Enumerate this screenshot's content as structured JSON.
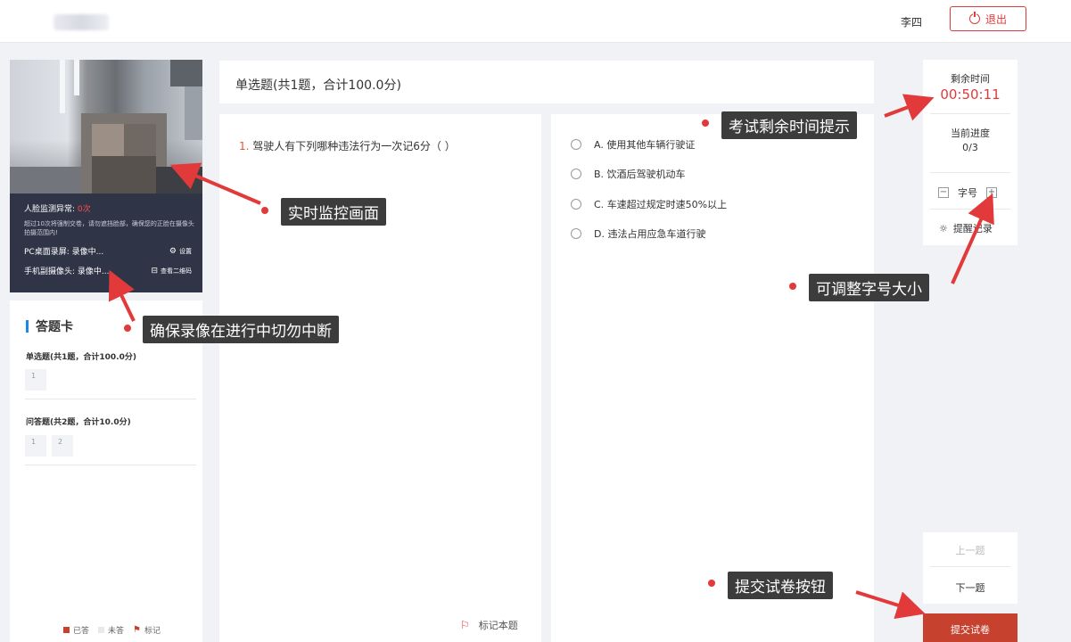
{
  "topbar": {
    "username": "李四",
    "logout_label": "退出"
  },
  "monitor": {
    "face_status_label": "人脸监测异常:",
    "face_status_count": "0次",
    "warning": "超过10次将强制交卷，请勿遮挡脸部，确保您的正脸在摄像头拍摄范围内!",
    "pc_record_label": "PC桌面录屏: 录像中...",
    "settings_label": "设置",
    "mobile_record_label": "手机副摄像头: 录像中...",
    "qr_label": "查看二维码"
  },
  "answer_card": {
    "title": "答题卡",
    "sections": [
      {
        "label": "单选题(共1题，合计100.0分)",
        "items": [
          "1"
        ]
      },
      {
        "label": "问答题(共2题，合计10.0分)",
        "items": [
          "1",
          "2"
        ]
      }
    ],
    "legend": {
      "answered": "已答",
      "unanswered": "未答",
      "marked": "标记"
    },
    "colors": {
      "answered": "#c7412f",
      "unanswered": "#e8e9ee",
      "marked": "#c7412f"
    }
  },
  "exam": {
    "section_header": "单选题(共1题，合计100.0分)",
    "question_number": "1.",
    "question_text": "驾驶人有下列哪种违法行为一次记6分（  ）",
    "mark_label": "标记本题",
    "options": [
      {
        "letter": "A.",
        "text": "使用其他车辆行驶证"
      },
      {
        "letter": "B.",
        "text": "饮酒后驾驶机动车"
      },
      {
        "letter": "C.",
        "text": "车速超过规定时速50%以上"
      },
      {
        "letter": "D.",
        "text": "违法占用应急车道行驶"
      }
    ]
  },
  "status": {
    "remaining_label": "剩余时间",
    "remaining_time": "00:50:11",
    "progress_label": "当前进度",
    "progress_value": "0/3",
    "font_label": "字号",
    "reminder_label": "提醒记录"
  },
  "nav": {
    "prev_label": "上一题",
    "next_label": "下一题",
    "submit_label": "提交试卷"
  },
  "annotations": {
    "monitor": "实时监控画面",
    "recording": "确保录像在进行中切勿中断",
    "timer": "考试剩余时间提示",
    "font": "可调整字号大小",
    "submit": "提交试卷按钮"
  },
  "accent_colors": {
    "red": "#e23a3a",
    "callout_bg": "#3c3c3c",
    "blue": "#1e88e5"
  }
}
